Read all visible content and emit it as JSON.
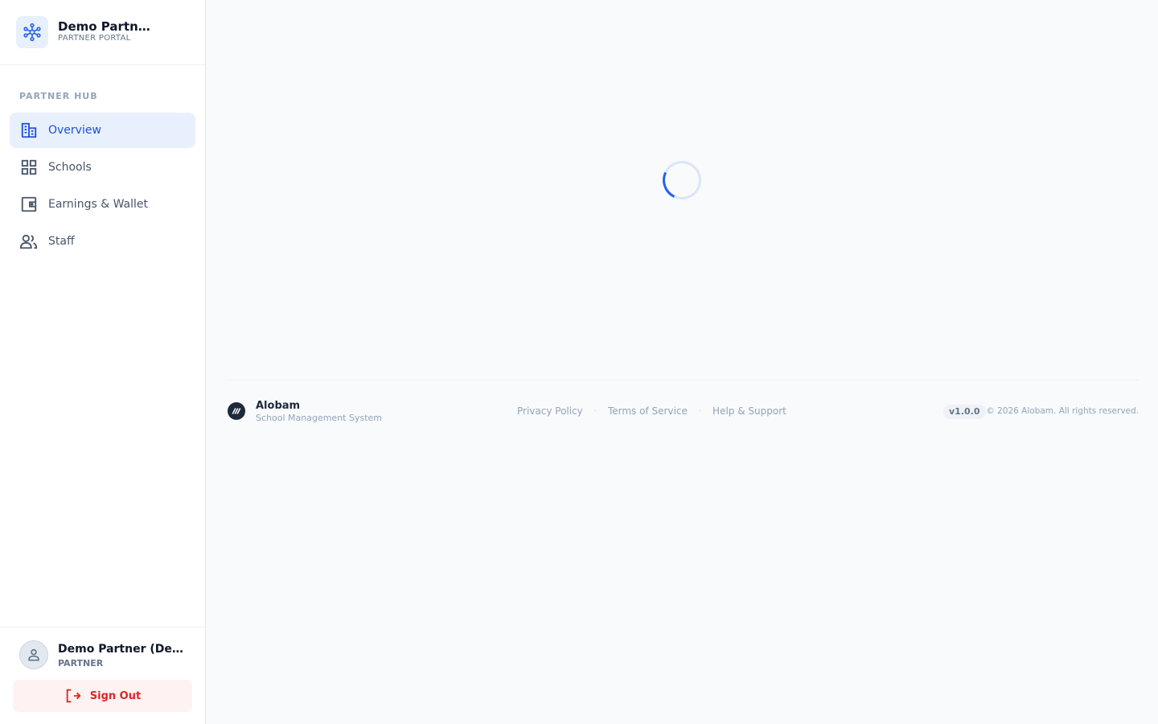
{
  "brand": {
    "title": "Demo Partner (Demo Partner)",
    "subtitle": "PARTNER PORTAL"
  },
  "nav": {
    "section_label": "PARTNER HUB",
    "items": [
      {
        "label": "Overview",
        "icon": "building-icon",
        "active": true
      },
      {
        "label": "Schools",
        "icon": "grid-icon",
        "active": false
      },
      {
        "label": "Earnings & Wallet",
        "icon": "wallet-icon",
        "active": false
      },
      {
        "label": "Staff",
        "icon": "users-icon",
        "active": false
      }
    ]
  },
  "user": {
    "name": "Demo Partner (Demo Partner)",
    "role": "PARTNER",
    "signout_label": "Sign Out"
  },
  "footer": {
    "name": "Alobam",
    "tagline": "School Management System",
    "links": [
      "Privacy Policy",
      "Terms of Service",
      "Help & Support"
    ],
    "version": "v1.0.0",
    "copyright": "© 2026 Alobam. All rights reserved."
  },
  "colors": {
    "accent": "#2563eb",
    "active_bg": "#e8f0fe",
    "danger": "#dc2626",
    "danger_bg": "#fef2f2"
  }
}
